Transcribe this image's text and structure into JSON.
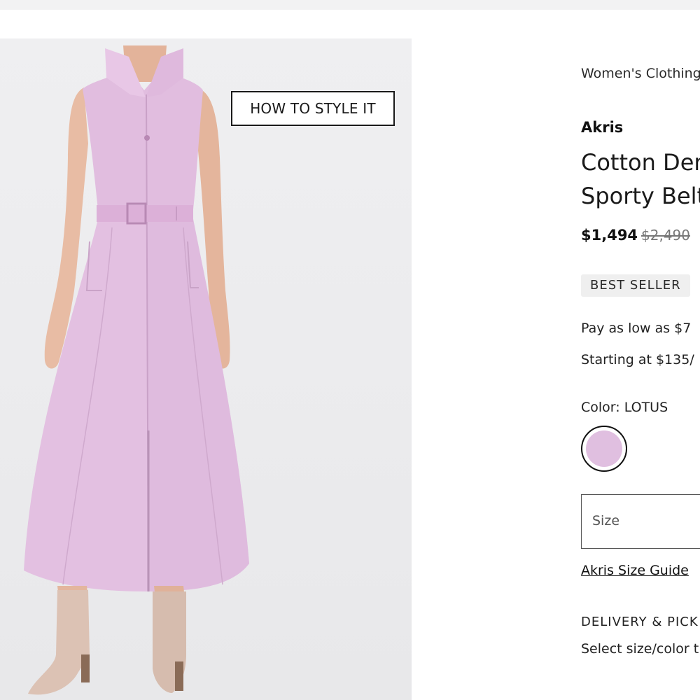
{
  "product_image": {
    "alt": "Cotton Denim Sporty Belted Dress in LOTUS",
    "style_button_label": "HOW TO STYLE IT"
  },
  "product": {
    "breadcrumb": "Women's Clothing",
    "brand": "Akris",
    "title_line1": "Cotton Denim",
    "title_line2": "Sporty Belted",
    "price": "$1,494",
    "original_price": "$2,490",
    "badge": "BEST SELLER",
    "pay_text": "Pay as low as $7",
    "starting_text": "Starting at $135/",
    "color_label": "Color: LOTUS",
    "selected_color_hex": "#e0bfe0",
    "size_placeholder": "Size",
    "size_guide_label": "Akris Size Guide",
    "delivery_heading": "DELIVERY & PICK",
    "select_note": "Select size/color t"
  },
  "colors": {
    "background": "#ffffff",
    "image_background": "#ececee",
    "dress": "#e2bfe0",
    "boots": "#dcc3b6",
    "skin": "#e7b9a0",
    "text": "#1a1a1a",
    "badge_bg": "#efefef"
  }
}
